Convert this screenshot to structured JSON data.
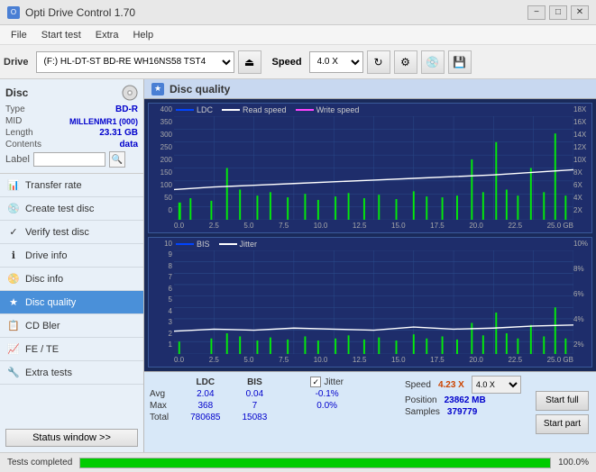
{
  "titlebar": {
    "title": "Opti Drive Control 1.70",
    "minimize": "−",
    "maximize": "□",
    "close": "✕"
  },
  "menubar": {
    "items": [
      "File",
      "Start test",
      "Extra",
      "Help"
    ]
  },
  "toolbar": {
    "drive_label": "Drive",
    "drive_value": "(F:)  HL-DT-ST BD-RE  WH16NS58 TST4",
    "speed_label": "Speed",
    "speed_value": "4.0 X"
  },
  "sidebar": {
    "disc_title": "Disc",
    "disc_fields": [
      {
        "key": "Type",
        "value": "BD-R"
      },
      {
        "key": "MID",
        "value": "MILLENMR1 (000)"
      },
      {
        "key": "Length",
        "value": "23.31 GB"
      },
      {
        "key": "Contents",
        "value": "data"
      },
      {
        "key": "Label",
        "value": ""
      }
    ],
    "nav_items": [
      {
        "label": "Transfer rate",
        "icon": "📊",
        "active": false
      },
      {
        "label": "Create test disc",
        "icon": "💿",
        "active": false
      },
      {
        "label": "Verify test disc",
        "icon": "✓",
        "active": false
      },
      {
        "label": "Drive info",
        "icon": "ℹ",
        "active": false
      },
      {
        "label": "Disc info",
        "icon": "📀",
        "active": false
      },
      {
        "label": "Disc quality",
        "icon": "★",
        "active": true
      },
      {
        "label": "CD Bler",
        "icon": "📋",
        "active": false
      },
      {
        "label": "FE / TE",
        "icon": "📈",
        "active": false
      },
      {
        "label": "Extra tests",
        "icon": "🔧",
        "active": false
      }
    ],
    "status_btn": "Status window >>"
  },
  "disc_quality": {
    "title": "Disc quality",
    "legend": [
      {
        "label": "LDC",
        "color": "#0044ff"
      },
      {
        "label": "Read speed",
        "color": "#ffffff"
      },
      {
        "label": "Write speed",
        "color": "#ff00ff"
      }
    ],
    "legend2": [
      {
        "label": "BIS",
        "color": "#0044ff"
      },
      {
        "label": "Jitter",
        "color": "#ffffff"
      }
    ]
  },
  "chart1": {
    "y_left": [
      "400",
      "350",
      "300",
      "250",
      "200",
      "150",
      "100",
      "50",
      "0"
    ],
    "y_right": [
      "18X",
      "16X",
      "14X",
      "12X",
      "10X",
      "8X",
      "6X",
      "4X",
      "2X"
    ],
    "x_axis": [
      "0.0",
      "2.5",
      "5.0",
      "7.5",
      "10.0",
      "12.5",
      "15.0",
      "17.5",
      "20.0",
      "22.5",
      "25.0 GB"
    ]
  },
  "chart2": {
    "y_left": [
      "10",
      "9",
      "8",
      "7",
      "6",
      "5",
      "4",
      "3",
      "2",
      "1"
    ],
    "y_right": [
      "10%",
      "8%",
      "6%",
      "4%",
      "2%"
    ],
    "x_axis": [
      "0.0",
      "2.5",
      "5.0",
      "7.5",
      "10.0",
      "12.5",
      "15.0",
      "17.5",
      "20.0",
      "22.5",
      "25.0 GB"
    ]
  },
  "stats": {
    "headers": [
      "LDC",
      "BIS",
      "",
      "Jitter",
      "Speed",
      ""
    ],
    "avg": {
      "ldc": "2.04",
      "bis": "0.04",
      "jitter": "-0.1%"
    },
    "max": {
      "ldc": "368",
      "bis": "7",
      "jitter": "0.0%"
    },
    "total": {
      "ldc": "780685",
      "bis": "15083"
    },
    "speed_current": "4.23 X",
    "speed_select": "4.0 X",
    "position": "23862 MB",
    "samples": "379779",
    "jitter_checked": true
  },
  "buttons": {
    "start_full": "Start full",
    "start_part": "Start part"
  },
  "progressbar": {
    "status": "Tests completed",
    "percent": "100.0%",
    "fill": 100
  }
}
